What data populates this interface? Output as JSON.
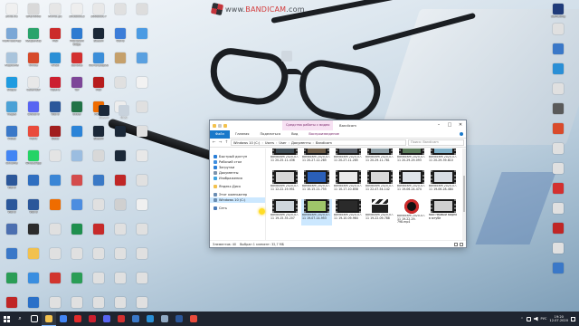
{
  "watermark": {
    "brand": "www.",
    "brand2": "BANDICAM",
    "brand3": ".com"
  },
  "desktop_icons": [
    {
      "label": "ZOIE.01",
      "color": "#f0f0f0"
    },
    {
      "label": "BMJ-0008",
      "color": "#d9d9d9"
    },
    {
      "label": "КОЛЕ.р1",
      "color": "#e6e6e6"
    },
    {
      "label": "20180512",
      "color": "#eeeeee"
    },
    {
      "label": "20080517",
      "color": "#e8e8e8"
    },
    {
      "label": "",
      "color": "#e0e0e0"
    },
    {
      "label": "",
      "color": "#dddddd"
    },
    {
      "label": "Компьютер",
      "color": "#7aa7d6"
    },
    {
      "label": "Kaspersky",
      "color": "#2aa36b"
    },
    {
      "label": "MSI",
      "color": "#cc2b2b"
    },
    {
      "label": "Microsoft Edge",
      "color": "#2e7bd1"
    },
    {
      "label": "Steam",
      "color": "#1b2838"
    },
    {
      "label": "Фото",
      "color": "#3c7dd8"
    },
    {
      "label": "",
      "color": "#4b9be3"
    },
    {
      "label": "Корзина",
      "color": "#a9c4dc"
    },
    {
      "label": "Office",
      "color": "#d64a2b"
    },
    {
      "label": "KASE",
      "color": "#2a8fd6"
    },
    {
      "label": "Запись",
      "color": "#d33030"
    },
    {
      "label": "Фотографии",
      "color": "#3b8ed9"
    },
    {
      "label": "",
      "color": "#c5a06b"
    },
    {
      "label": "",
      "color": "#5aa0e0"
    },
    {
      "label": "Skype",
      "color": "#1e9be0"
    },
    {
      "label": "Calendar",
      "color": "#e8e8e8"
    },
    {
      "label": "Opera",
      "color": "#cc1f2f"
    },
    {
      "label": "Tor",
      "color": "#7d4698"
    },
    {
      "label": "MSI",
      "color": "#b71c1c"
    },
    {
      "label": "",
      "color": "#e0e0e0"
    },
    {
      "label": "",
      "color": "#f2f2f2"
    },
    {
      "label": "Vegas",
      "color": "#4aa1d6"
    },
    {
      "label": "Discord",
      "color": "#5865f2"
    },
    {
      "label": "Word",
      "color": "#2b579a"
    },
    {
      "label": "Excel",
      "color": "#217346"
    },
    {
      "label": "Avast",
      "color": "#ef6c00"
    },
    {
      "label": "",
      "color": "#ededed"
    },
    {
      "label": "",
      "color": "#e0e0e0"
    },
    {
      "label": "Video",
      "color": "#3a78c8"
    },
    {
      "label": "Paint",
      "color": "#e94b3c"
    },
    {
      "label": "Dota",
      "color": "#a11e1e"
    },
    {
      "label": "",
      "color": "#2b84d8"
    },
    {
      "label": "Steam",
      "color": "#1b2838"
    },
    {
      "label": "",
      "color": "#1b2838"
    },
    {
      "label": "",
      "color": "#e0e0e0"
    },
    {
      "label": "Chrome",
      "color": "#4285f4"
    },
    {
      "label": "WhatsApp",
      "color": "#25d366"
    },
    {
      "label": "",
      "color": "#e4e4e4"
    },
    {
      "label": "",
      "color": "#9bbde0"
    },
    {
      "label": "",
      "color": "#d8d8d8"
    },
    {
      "label": "",
      "color": "#1b2838"
    },
    {
      "label": "",
      "color": "#e8e8e8"
    },
    {
      "label": "Word",
      "color": "#2b579a"
    },
    {
      "label": "",
      "color": "#2f6fc0"
    },
    {
      "label": "",
      "color": "#3a86d6"
    },
    {
      "label": "",
      "color": "#d44c4c"
    },
    {
      "label": "",
      "color": "#3a79c6"
    },
    {
      "label": "",
      "color": "#c02626"
    },
    {
      "label": "",
      "color": "#e0e0e0"
    },
    {
      "label": "Word",
      "color": "#2b579a"
    },
    {
      "label": "Word",
      "color": "#2b579a"
    },
    {
      "label": "",
      "color": "#ef6c00"
    },
    {
      "label": "",
      "color": "#4c8de0"
    },
    {
      "label": "",
      "color": "#e0e0e0"
    },
    {
      "label": "",
      "color": "#d0d0d0"
    },
    {
      "label": "",
      "color": "#f0f0f0"
    },
    {
      "label": "",
      "color": "#4c6fb0"
    },
    {
      "label": "",
      "color": "#2c2c2c"
    },
    {
      "label": "",
      "color": "#e0e0e0"
    },
    {
      "label": "",
      "color": "#1f8f4e"
    },
    {
      "label": "",
      "color": "#c72a2a"
    },
    {
      "label": "",
      "color": "#e0e0e0"
    },
    {
      "label": "",
      "color": "#e0e0e0"
    },
    {
      "label": "",
      "color": "#3a78c8"
    },
    {
      "label": "",
      "color": "#f2c14e"
    },
    {
      "label": "",
      "color": "#e0e0e0"
    },
    {
      "label": "",
      "color": "#e0e0e0"
    },
    {
      "label": "",
      "color": "#e0e0e0"
    },
    {
      "label": "",
      "color": "#e0e0e0"
    },
    {
      "label": "",
      "color": "#e0e0e0"
    },
    {
      "label": "",
      "color": "#2a9d56"
    },
    {
      "label": "",
      "color": "#3a8ee0"
    },
    {
      "label": "",
      "color": "#d1352e"
    },
    {
      "label": "",
      "color": "#2a9d56"
    },
    {
      "label": "",
      "color": "#e0e0e0"
    },
    {
      "label": "",
      "color": "#e0e0e0"
    },
    {
      "label": "",
      "color": "#e0e0e0"
    },
    {
      "label": "",
      "color": "#c02626"
    },
    {
      "label": "",
      "color": "#2a70c8"
    },
    {
      "label": "",
      "color": "#e0e0e0"
    },
    {
      "label": "",
      "color": "#e0e0e0"
    },
    {
      "label": "",
      "color": "#e0e0e0"
    },
    {
      "label": "",
      "color": "#e0e0e0"
    },
    {
      "label": "",
      "color": "#e0e0e0"
    }
  ],
  "right_icons": [
    {
      "label": "Samsung",
      "color": "#1f3b7a"
    },
    {
      "label": "",
      "color": "#e0e0e0"
    },
    {
      "label": "",
      "color": "#3a78c8"
    },
    {
      "label": "",
      "color": "#2a8fd6"
    },
    {
      "label": "",
      "color": "#e0e0e0"
    },
    {
      "label": "",
      "color": "#5a5a5a"
    },
    {
      "label": "",
      "color": "#d94a2b"
    },
    {
      "label": "",
      "color": "#e0e0e0"
    },
    {
      "label": "",
      "color": "#e0e0e0"
    },
    {
      "label": "",
      "color": "#d33030"
    },
    {
      "label": "",
      "color": "#e0e0e0"
    },
    {
      "label": "",
      "color": "#c02626"
    },
    {
      "label": "",
      "color": "#e0e0e0"
    },
    {
      "label": "",
      "color": "#3a78c8"
    }
  ],
  "extra_icons": [
    {
      "label": "Steam",
      "color": "#1b2838"
    },
    {
      "label": "NCsI",
      "color": "#c8d2dc"
    },
    {
      "label": "",
      "color": "#d0d8e0"
    }
  ],
  "explorer": {
    "context_tab": "Средства работы с видео",
    "title": "Bandicam",
    "ribbon_tabs": {
      "file": "Файл",
      "home": "Главная",
      "share": "Поделиться",
      "view": "Вид",
      "manage": "Воспроизведение"
    },
    "path": [
      "Windows 10 (C:)",
      "Users",
      "User",
      "Документы",
      "Bandicam"
    ],
    "search_placeholder": "Поиск: Bandicam",
    "nav": [
      {
        "label": "Быстрый доступ",
        "color": "#2a7fd8",
        "gap": false
      },
      {
        "label": "Рабочий стол",
        "color": "#3f8fe0",
        "gap": false
      },
      {
        "label": "Загрузки",
        "color": "#2a7fd8",
        "gap": false
      },
      {
        "label": "Документы",
        "color": "#7c94ad",
        "gap": false
      },
      {
        "label": "Изображения",
        "color": "#3fa4e0",
        "gap": false
      },
      {
        "label": "Яндекс.Диск",
        "color": "#f2c14e",
        "gap": true
      },
      {
        "label": "Этот компьютер",
        "color": "#6a8db3",
        "gap": true
      },
      {
        "label": "Windows 10 (C:)",
        "color": "#6a8db3",
        "gap": false,
        "sel": true
      },
      {
        "label": "Сеть",
        "color": "#4a7ab8",
        "gap": true
      }
    ],
    "files": [
      {
        "name": "bandicam 2020-07-11 20-25-11-436",
        "kind": "video",
        "scr": "#3e4c55"
      },
      {
        "name": "bandicam 2020-07-11 20-27-12-285",
        "kind": "video",
        "scr": "#6b5a45"
      },
      {
        "name": "bandicam 2020-07-11 20-27-11-285",
        "kind": "video",
        "scr": "#59606a"
      },
      {
        "name": "bandicam 2020-07-11 20-29-11-781",
        "kind": "video",
        "scr": "#8fa0a8"
      },
      {
        "name": "bandicam 2020-07-11 20-29-29-093",
        "kind": "video",
        "scr": "#5a7b5a"
      },
      {
        "name": "bandicam 2020-07-11 20-29-39-810",
        "kind": "video",
        "scr": "#7fb0c8"
      },
      {
        "name": "bandicam 2020-07-11 12-22-19-951",
        "kind": "video",
        "scr": "#d8d8d8"
      },
      {
        "name": "bandicam 2020-07-11 10-15-21-755",
        "kind": "video",
        "scr": "#2a5fb8"
      },
      {
        "name": "bandicam 2020-07-11 10-17-10-858",
        "kind": "video",
        "scr": "#e9e9e9"
      },
      {
        "name": "bandicam 2020-07-11 22-47-54-142",
        "kind": "video",
        "scr": "#d9d9d9"
      },
      {
        "name": "bandicam 2020-07-11 19-06-24-474",
        "kind": "video",
        "scr": "#dfe4ea"
      },
      {
        "name": "bandicam 2020-07-11 19-06-28-484",
        "kind": "video",
        "scr": "#d8dde3"
      },
      {
        "name": "bandicam 2020-07-11 19-15-35-207",
        "kind": "video",
        "scr": "#cfd6dc"
      },
      {
        "name": "bandicam 2020-07-11 19-07-14-953",
        "kind": "video",
        "scr": "#9fc56a",
        "sel": true
      },
      {
        "name": "bandicam 2020-07-11 19-10-09-964",
        "kind": "video",
        "scr": "#2a2a2a"
      },
      {
        "name": "bandicam 2020-07-11 19-22-09-788",
        "kind": "clap",
        "scr": ""
      },
      {
        "name": "bandicam 2020-07-11 19-22-29-798.mp4",
        "kind": "disc",
        "scr": ""
      },
      {
        "name": "мой первый видео в ютубе",
        "kind": "video",
        "scr": "#cfcfcf"
      }
    ],
    "status": {
      "count": "Элементов: 40",
      "selected": "Выбран 1 элемент: 32,7 МБ"
    }
  },
  "taskbar": {
    "apps": [
      {
        "name": "task-view",
        "color": "#ffffff"
      },
      {
        "name": "explorer",
        "color": "#f2c14e",
        "active": true
      },
      {
        "name": "chrome",
        "color": "#4285f4"
      },
      {
        "name": "yandex",
        "color": "#e12b2b"
      },
      {
        "name": "opera",
        "color": "#cc1f2f"
      },
      {
        "name": "discord",
        "color": "#5865f2"
      },
      {
        "name": "bandicam",
        "color": "#d33030"
      },
      {
        "name": "photos",
        "color": "#3a78c8"
      },
      {
        "name": "store",
        "color": "#2a8fd6"
      },
      {
        "name": "steam",
        "color": "#8fa8c2"
      },
      {
        "name": "word",
        "color": "#2b579a"
      },
      {
        "name": "paint",
        "color": "#e94b3c"
      }
    ],
    "lang": "РУС",
    "time": "19:20",
    "date": "12.07.2020"
  }
}
